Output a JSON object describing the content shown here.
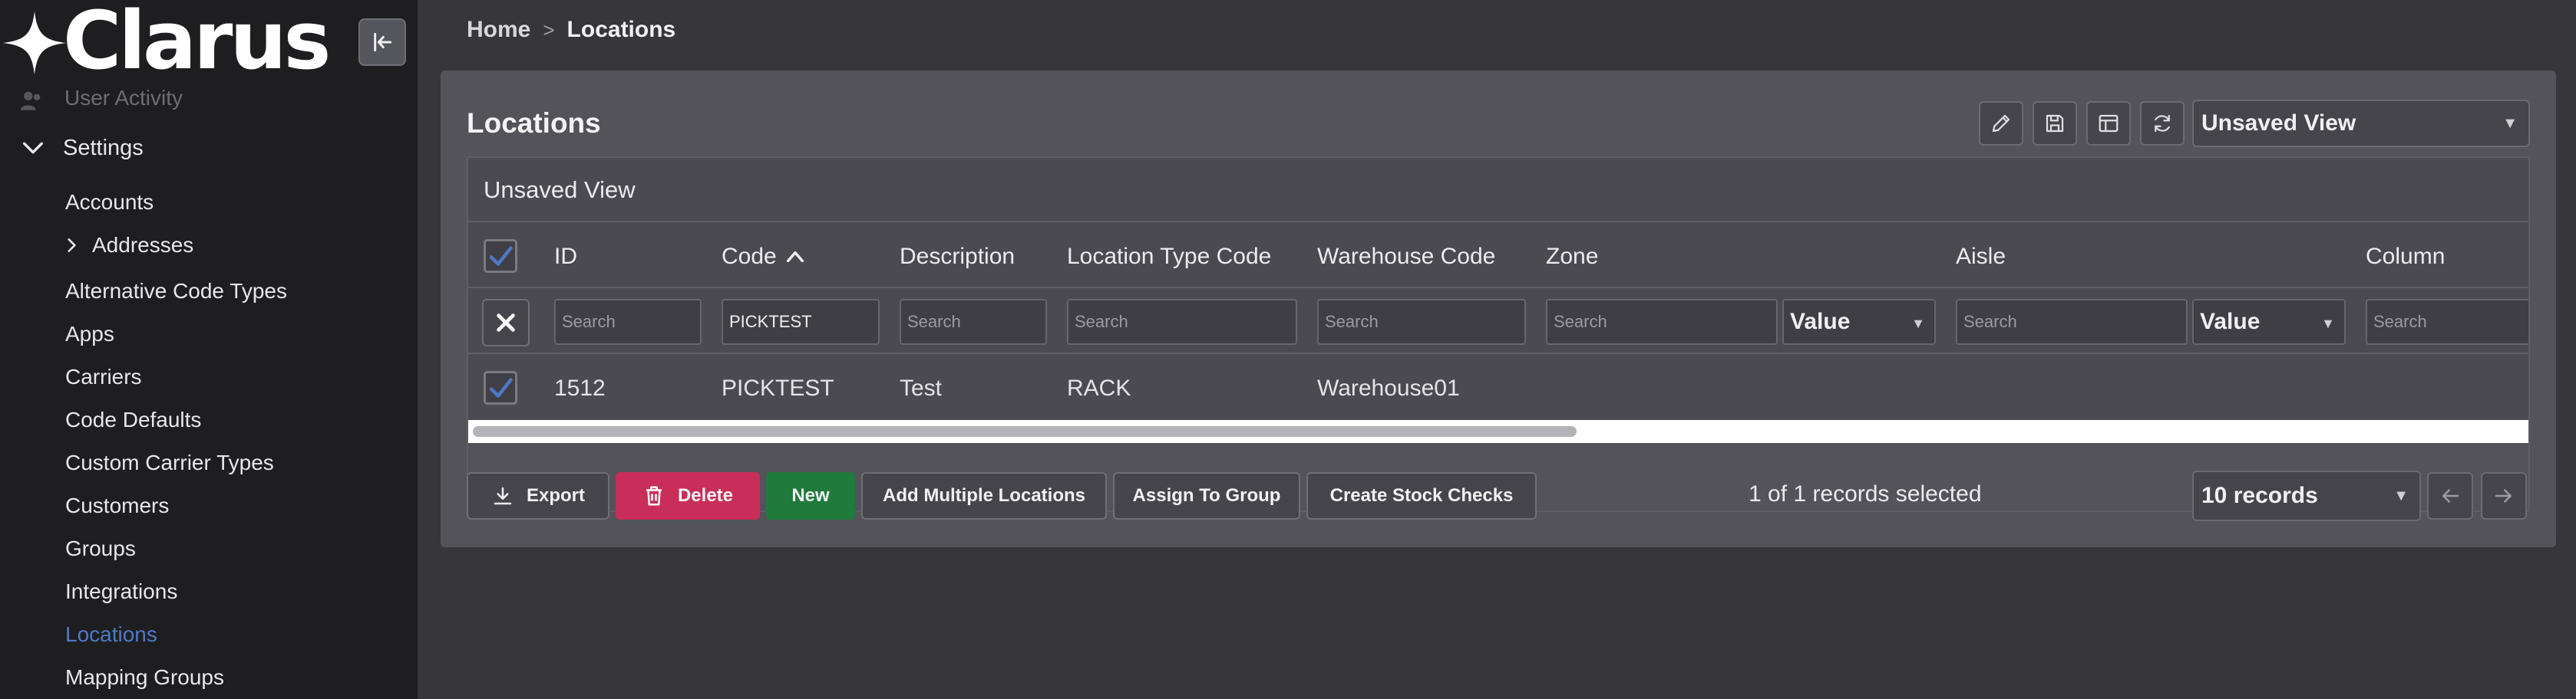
{
  "app": {
    "name": "Clarus"
  },
  "sidebar": {
    "faded_item": "User Activity",
    "settings_label": "Settings",
    "items": [
      {
        "label": "Accounts"
      },
      {
        "label": "Addresses"
      },
      {
        "label": "Alternative Code Types"
      },
      {
        "label": "Apps"
      },
      {
        "label": "Carriers"
      },
      {
        "label": "Code Defaults"
      },
      {
        "label": "Custom Carrier Types"
      },
      {
        "label": "Customers"
      },
      {
        "label": "Groups"
      },
      {
        "label": "Integrations"
      },
      {
        "label": "Locations"
      },
      {
        "label": "Mapping Groups"
      }
    ],
    "active_item": "Locations"
  },
  "breadcrumb": {
    "home": "Home",
    "separator": ">",
    "current": "Locations"
  },
  "card": {
    "title": "Locations",
    "view_select": "Unsaved View"
  },
  "grid": {
    "caption": "Unsaved View",
    "columns": [
      "ID",
      "Code",
      "Description",
      "Location Type Code",
      "Warehouse Code",
      "Zone",
      "Aisle",
      "Column"
    ],
    "sorted_column": "Code",
    "sort_direction": "ascending",
    "filters": {
      "placeholder": "Search",
      "code_value": "PICKTEST",
      "zone_operator": "Value",
      "aisle_operator": "Value"
    },
    "rows": [
      {
        "id": "1512",
        "code": "PICKTEST",
        "description": "Test",
        "location_type_code": "RACK",
        "warehouse_code": "Warehouse01",
        "selected": true
      }
    ],
    "all_selected": true
  },
  "actions": {
    "export": "Export",
    "delete": "Delete",
    "new": "New",
    "add_multiple": "Add Multiple Locations",
    "assign_group": "Assign To Group",
    "create_stock_checks": "Create Stock Checks"
  },
  "pagination": {
    "status": "1 of 1 records selected",
    "page_size": "10 records"
  },
  "colors": {
    "accent": "#4f79c8",
    "delete": "#c82e59",
    "new": "#1f7a3c",
    "sidebar_bg": "#1e1e21",
    "content_bg": "#36363b"
  }
}
